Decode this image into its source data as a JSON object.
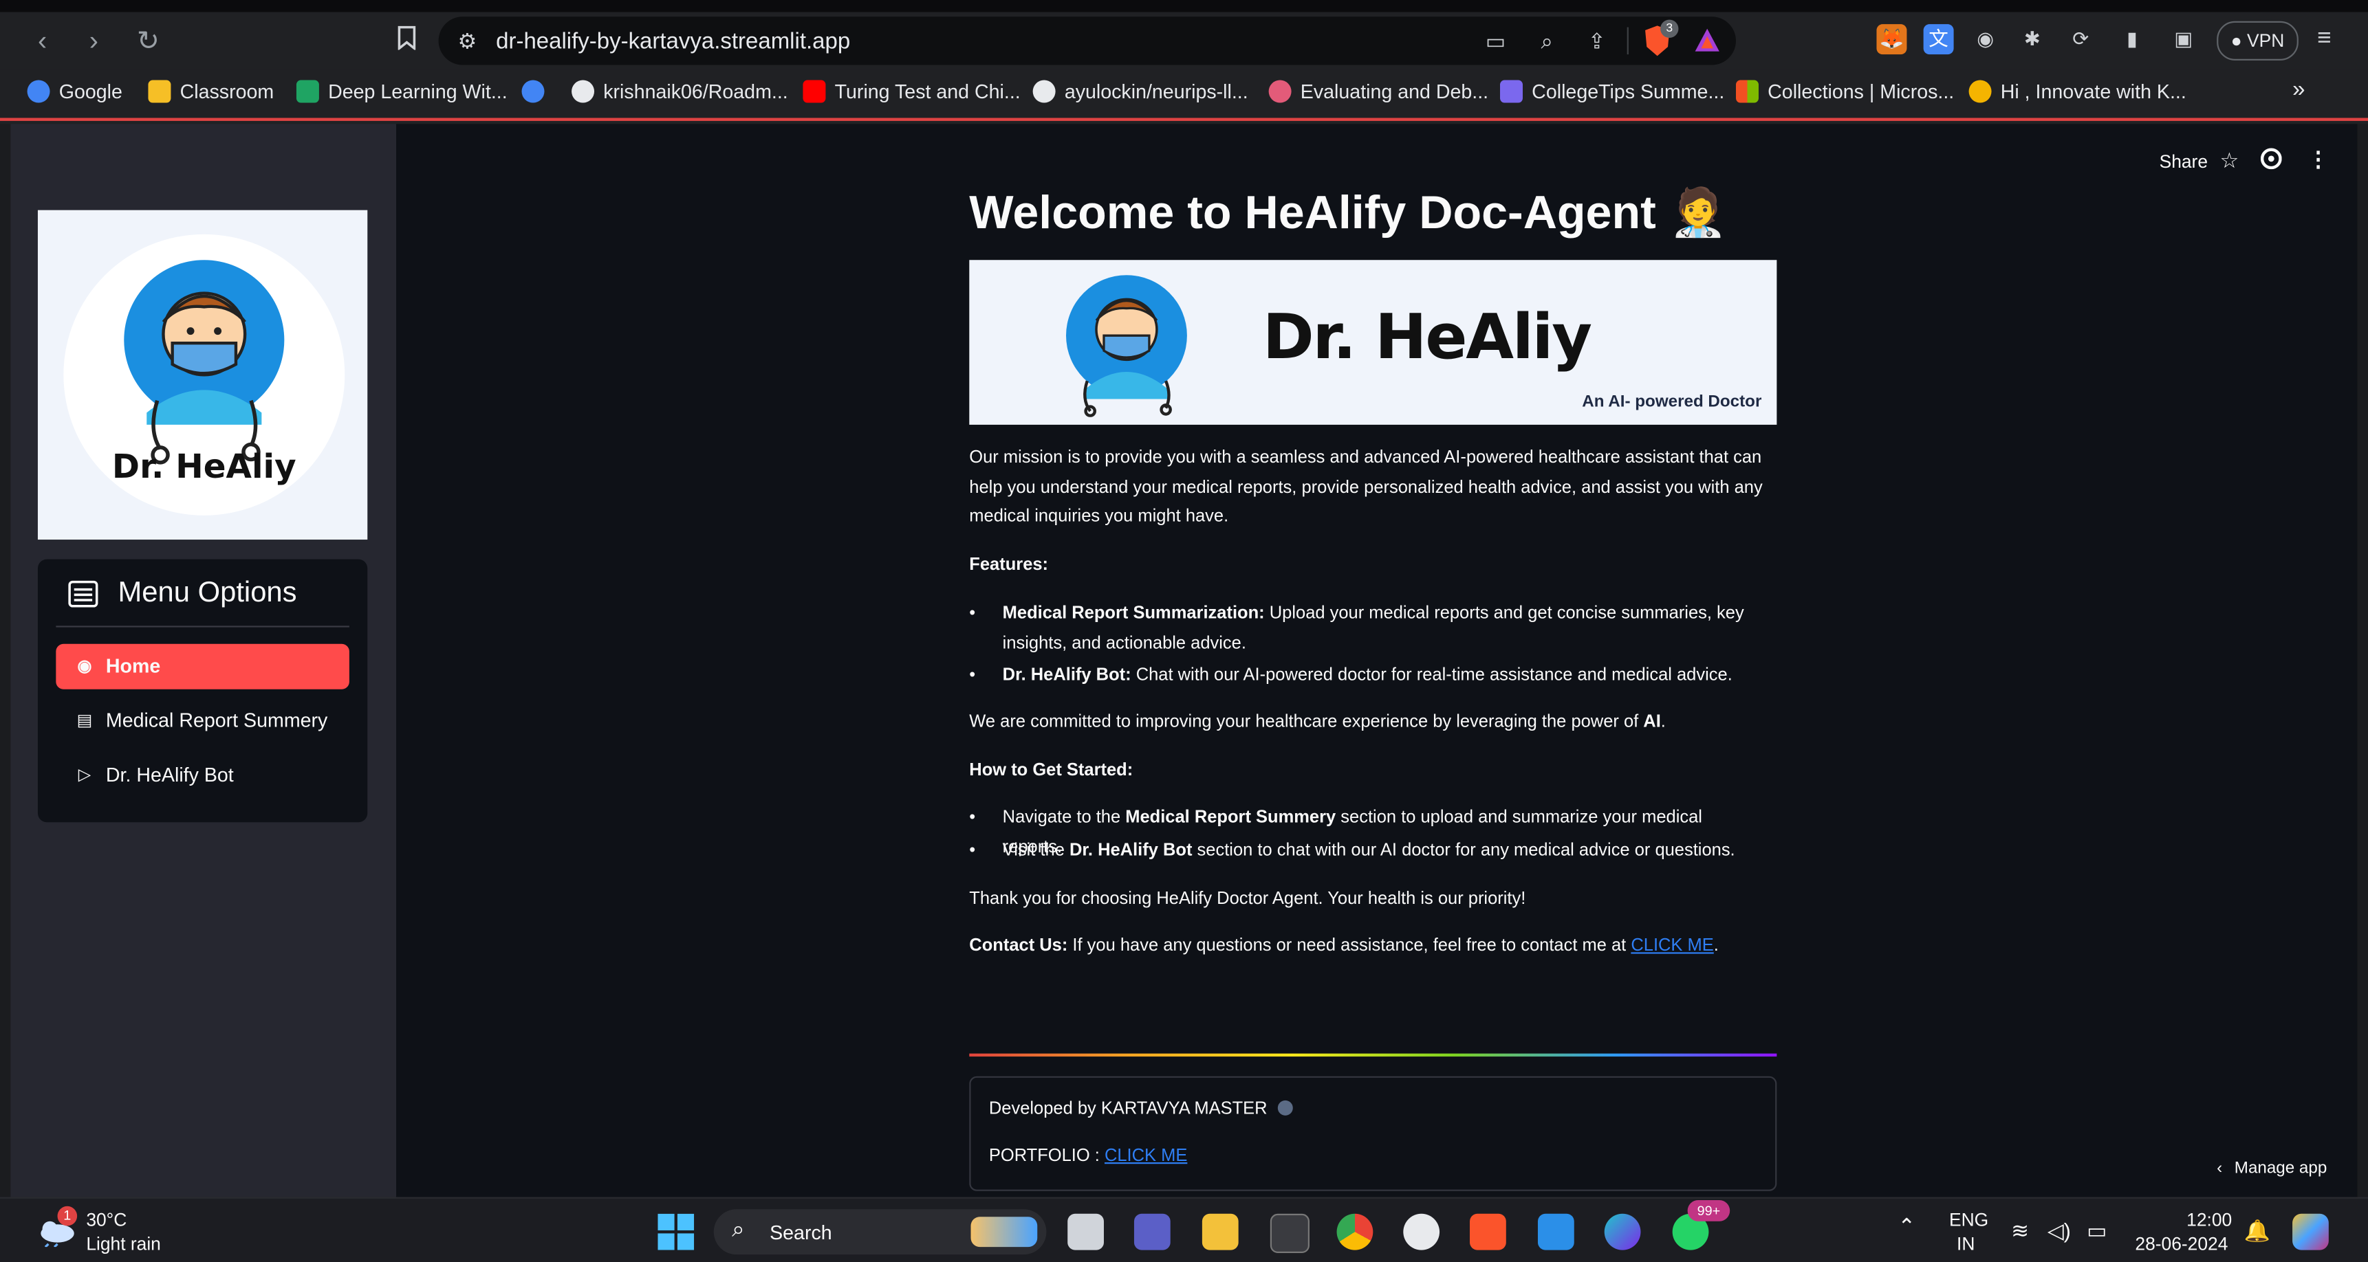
{
  "browser": {
    "url": "dr-healify-by-kartavya.streamlit.app",
    "vpn_label": "VPN",
    "brave_badge": "3",
    "bookmarks": [
      {
        "label": "Google",
        "icon": "google-icon",
        "color": "#4285f4"
      },
      {
        "label": "Classroom",
        "icon": "classroom-icon",
        "color": "#f6bf26"
      },
      {
        "label": "Deep Learning Wit...",
        "icon": "drive-icon",
        "color": "#1fa463"
      },
      {
        "label": "",
        "icon": "google-icon",
        "color": "#4285f4"
      },
      {
        "label": "krishnaik06/Roadm...",
        "icon": "github-icon",
        "color": "#e8eaed"
      },
      {
        "label": "Turing Test and Chi...",
        "icon": "youtube-icon",
        "color": "#ff0000"
      },
      {
        "label": "ayulockin/neurips-ll...",
        "icon": "github-icon",
        "color": "#e8eaed"
      },
      {
        "label": "Evaluating and Deb...",
        "icon": "wandb-icon",
        "color": "#e35b79"
      },
      {
        "label": "CollegeTips Summe...",
        "icon": "list-icon",
        "color": "#7b68ee"
      },
      {
        "label": "Collections | Micros...",
        "icon": "microsoft-icon",
        "color": "#f25022"
      },
      {
        "label": "Hi , Innovate with K...",
        "icon": "avatar-icon",
        "color": "#f4b400"
      }
    ],
    "more_bookmarks": "»"
  },
  "app": {
    "share_label": "Share",
    "sidebar": {
      "logo_text": "Dr. HeAliy",
      "menu_title": "Menu Options",
      "items": [
        {
          "label": "Home",
          "icon": "person-circle-icon",
          "active": true
        },
        {
          "label": "Medical Report Summery",
          "icon": "document-icon",
          "active": false
        },
        {
          "label": "Dr. HeAlify Bot",
          "icon": "play-icon",
          "active": false
        }
      ]
    },
    "title": "Welcome to HeAlify Doc-Agent",
    "title_emoji": "🧑‍⚕️",
    "banner": {
      "name": "Dr. HeAliy",
      "tagline": "An AI- powered Doctor"
    },
    "mission": "Our mission is to provide you with a seamless and advanced AI-powered healthcare assistant that can help you understand your medical reports, provide personalized health advice, and assist you with any medical inquiries you might have.",
    "features_heading": "Features:",
    "features": [
      {
        "bold": "Medical Report Summarization:",
        "text": " Upload your medical reports and get concise summaries, key insights, and actionable advice."
      },
      {
        "bold": "Dr. HeAlify Bot:",
        "text": " Chat with our AI-powered doctor for real-time assistance and medical advice."
      }
    ],
    "commitment_pre": "We are committed to improving your healthcare experience by leveraging the power of ",
    "commitment_bold": "AI",
    "commitment_post": ".",
    "how_heading": "How to Get Started:",
    "steps": [
      {
        "pre": "Navigate to the ",
        "bold": "Medical Report Summery",
        "post": " section to upload and summarize your medical reports."
      },
      {
        "pre": "Visit the ",
        "bold": "Dr. HeAlify Bot",
        "post": " section to chat with our AI doctor for any medical advice or questions."
      }
    ],
    "thanks": "Thank you for choosing HeAlify Doctor Agent. Your health is our priority!",
    "contact_bold": "Contact Us:",
    "contact_text": " If you have any questions or need assistance, feel free to contact me at ",
    "contact_link": "CLICK ME",
    "contact_end": ".",
    "footer": {
      "developed_by": "Developed by KARTAVYA MASTER",
      "portfolio_label": "PORTFOLIO : ",
      "portfolio_link": "CLICK ME"
    },
    "manage_app": "Manage app"
  },
  "taskbar": {
    "weather_temp": "30°C",
    "weather_desc": "Light rain",
    "weather_badge": "1",
    "search_label": "Search",
    "whatsapp_badge": "99+",
    "lang_top": "ENG",
    "lang_bottom": "IN",
    "time": "12:00",
    "date": "28-06-2024"
  },
  "colors": {
    "accent": "#ff4b4b",
    "link": "#2f7ff5",
    "app_bg": "#0e1117",
    "sidebar_bg": "#262730"
  }
}
